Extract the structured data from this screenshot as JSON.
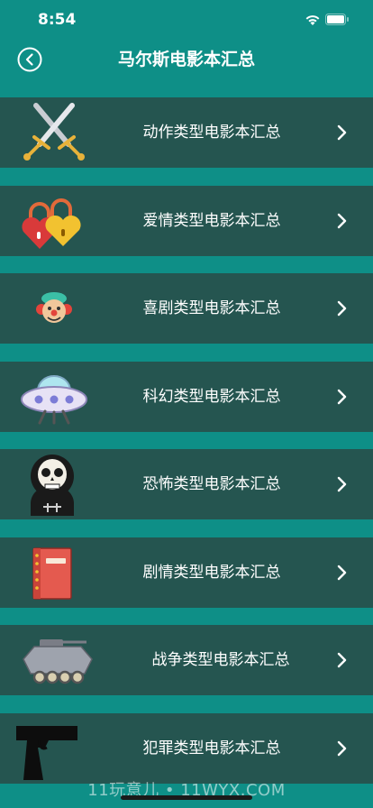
{
  "status_bar": {
    "time": "8:54"
  },
  "nav": {
    "title": "马尔斯电影本汇总"
  },
  "categories": [
    {
      "label": "动作类型电影本汇总",
      "icon": "crossed-swords-icon"
    },
    {
      "label": "爱情类型电影本汇总",
      "icon": "love-locks-icon"
    },
    {
      "label": "喜剧类型电影本汇总",
      "icon": "clown-face-icon"
    },
    {
      "label": "科幻类型电影本汇总",
      "icon": "ufo-icon"
    },
    {
      "label": "恐怖类型电影本汇总",
      "icon": "skull-icon"
    },
    {
      "label": "剧情类型电影本汇总",
      "icon": "notebook-icon"
    },
    {
      "label": "战争类型电影本汇总",
      "icon": "armored-vehicle-icon"
    },
    {
      "label": "犯罪类型电影本汇总",
      "icon": "pistol-icon"
    }
  ],
  "watermark": "11玩意儿 • 11WYX.COM",
  "colors": {
    "background": "#0e8f87",
    "row": "#255550"
  }
}
